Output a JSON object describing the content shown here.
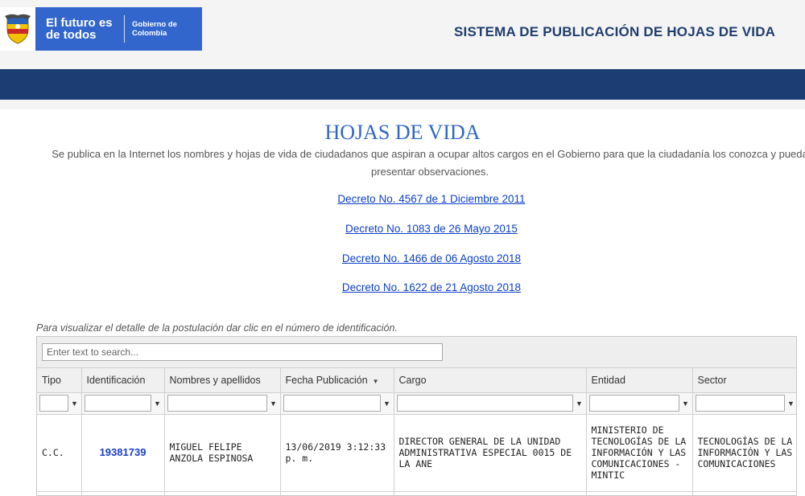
{
  "header": {
    "brand_main": "El futuro es de todos",
    "brand_sub": "Gobierno de Colombia",
    "system_title": "SISTEMA DE PUBLICACIÓN DE HOJAS DE VIDA"
  },
  "main": {
    "title": "HOJAS DE VIDA",
    "intro": "Se publica en la Internet los nombres y hojas de vida de ciudadanos que aspiran a ocupar altos cargos en el Gobierno para que la ciudadanía los conozca y pueda presentar observaciones.",
    "decrees": [
      "Decreto No. 4567 de 1 Diciembre 2011",
      "Decreto No. 1083 de 26 Mayo 2015",
      "Decreto No. 1466 de 06 Agosto 2018",
      "Decreto No. 1622 de 21 Agosto 2018"
    ],
    "hint": "Para visualizar el detalle de la postulación dar clic en el número de identificación."
  },
  "grid": {
    "search_placeholder": "Enter text to search...",
    "columns": [
      "Tipo",
      "Identificación",
      "Nombres y apellidos",
      "Fecha Publicación",
      "Cargo",
      "Entidad",
      "Sector"
    ],
    "rows": [
      {
        "tipo": "C.C.",
        "id": "19381739",
        "nombre": "MIGUEL FELIPE ANZOLA ESPINOSA",
        "fecha": "13/06/2019 3:12:33 p. m.",
        "cargo": "DIRECTOR GENERAL DE LA UNIDAD ADMINISTRATIVA ESPECIAL 0015 DE LA ANE",
        "entidad": "MINISTERIO DE TECNOLOGÍAS DE LA INFORMACIÓN Y LAS COMUNICACIONES - MINTIC",
        "sector": "TECNOLOGÍAS DE LA INFORMACIÓN Y LAS COMUNICACIONES"
      }
    ]
  },
  "colors": {
    "brand_blue": "#3366cc",
    "nav_blue": "#1b3d74",
    "title_blue": "#2f67c4",
    "link_blue": "#0b3fc7"
  },
  "icons": {
    "filter": "filter-icon",
    "sort": "sort-descending-icon",
    "shield": "colombia-shield-icon"
  }
}
